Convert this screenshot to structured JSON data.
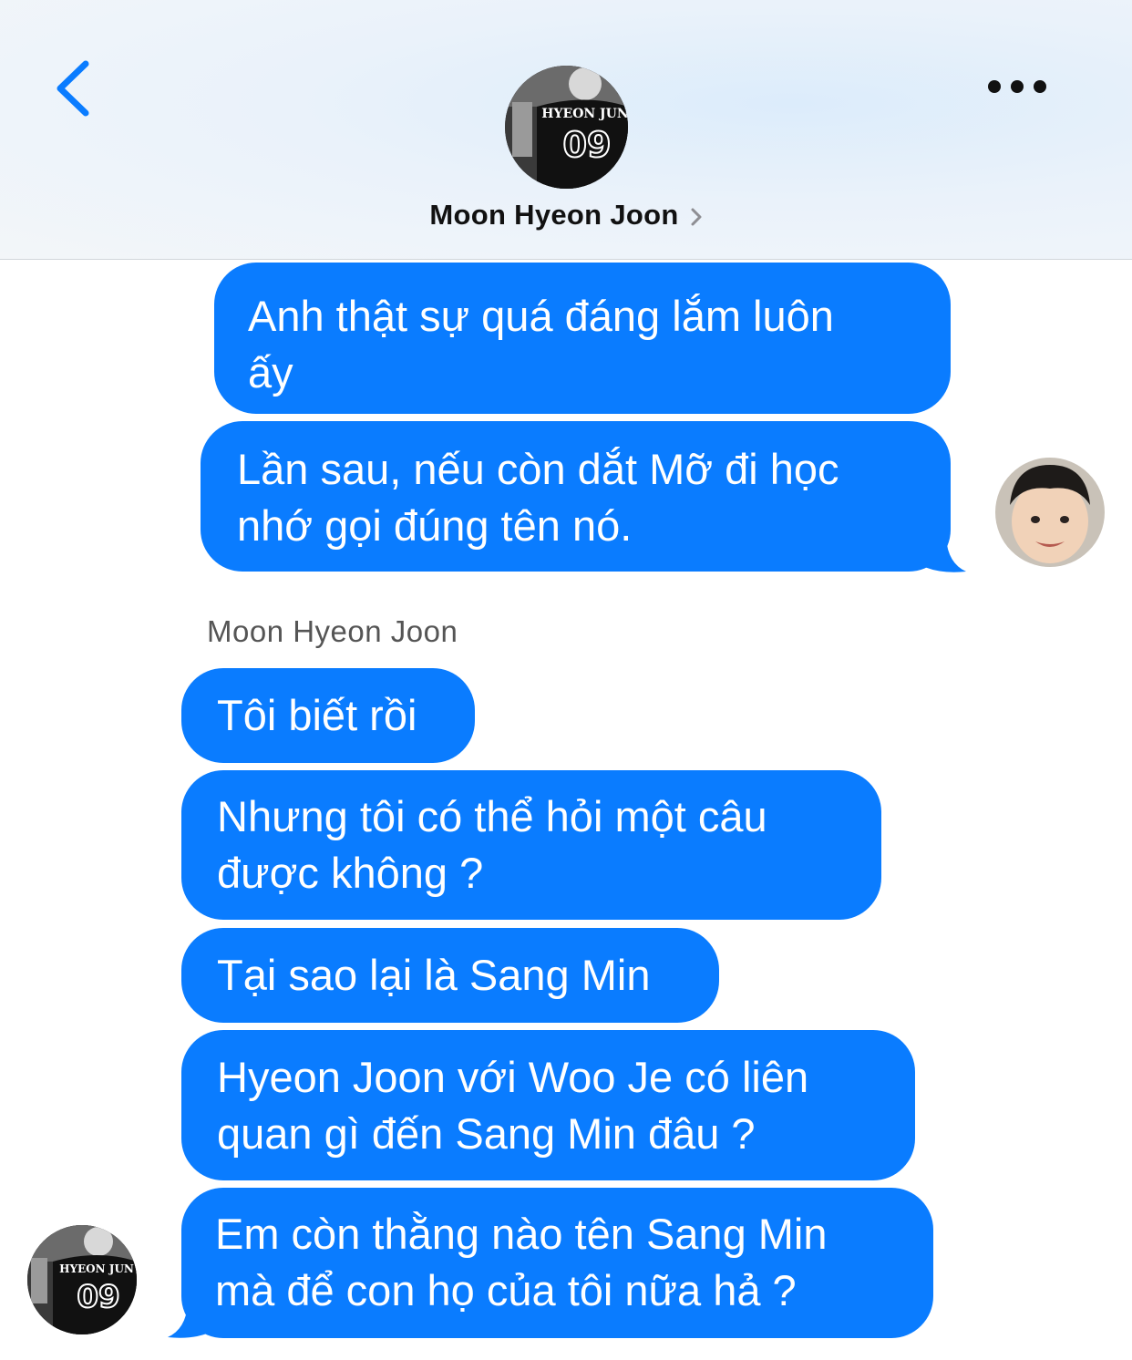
{
  "header": {
    "contact_name": "Moon Hyeon Joon",
    "avatar_text_top": "HYEON JUN",
    "avatar_text_number": "09"
  },
  "colors": {
    "bubble": "#0a7cff",
    "accent": "#0a7cff",
    "header_bg": "#eaf2fa"
  },
  "icons": {
    "back": "chevron-left-icon",
    "more": "more-horizontal-icon",
    "name_chevron": "chevron-right-icon"
  },
  "messages_sent": [
    {
      "line1": "Anh thật sự quá đáng lắm luôn",
      "line2": "ấy"
    },
    {
      "line1": "Lần sau, nếu còn dắt Mỡ đi học",
      "line2": "nhớ gọi đúng tên nó."
    }
  ],
  "sender_label": "Moon Hyeon Joon",
  "messages_received": [
    {
      "line1": "Tôi biết rồi"
    },
    {
      "line1": "Nhưng tôi có thể hỏi một câu",
      "line2": "được không ?"
    },
    {
      "line1": "Tại sao lại là Sang Min"
    },
    {
      "line1": "Hyeon Joon với Woo Je có liên",
      "line2": "quan gì đến Sang Min đâu ?"
    },
    {
      "line1": "Em còn thằng nào tên Sang Min",
      "line2": "mà để con họ của tôi nữa hả ?"
    }
  ]
}
